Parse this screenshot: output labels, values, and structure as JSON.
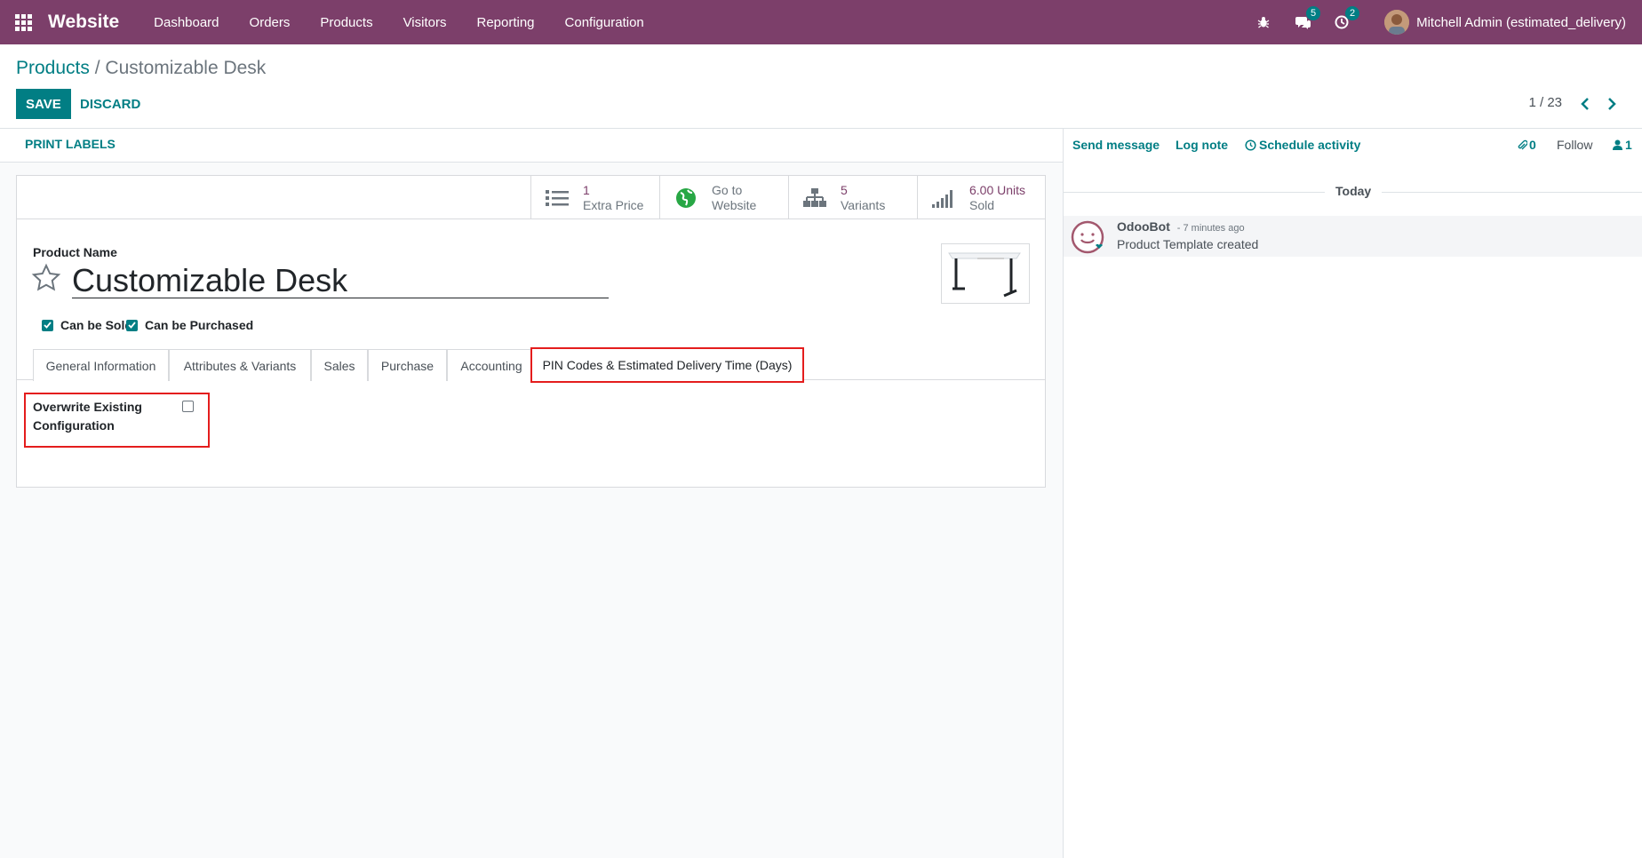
{
  "navbar": {
    "app_name": "Website",
    "menu": [
      "Dashboard",
      "Orders",
      "Products",
      "Visitors",
      "Reporting",
      "Configuration"
    ],
    "messages_count": "5",
    "activities_count": "2",
    "user": "Mitchell Admin (estimated_delivery)",
    "color": "#7c3f6a"
  },
  "breadcrumb": {
    "parent": "Products",
    "separator": "/",
    "current": "Customizable Desk"
  },
  "actions": {
    "save": "SAVE",
    "discard": "DISCARD"
  },
  "pager": {
    "text": "1 / 23"
  },
  "statusbar": {
    "print_labels": "PRINT LABELS"
  },
  "smart_buttons": [
    {
      "value": "1",
      "label": "Extra Price",
      "icon": "list-icon"
    },
    {
      "value": "Go to",
      "label": "Website",
      "icon": "globe-icon"
    },
    {
      "value": "5",
      "label": "Variants",
      "icon": "sitemap-icon"
    },
    {
      "value": "6.00 Units",
      "label": "Sold",
      "icon": "signal-icon"
    }
  ],
  "product": {
    "name_label": "Product Name",
    "name": "Customizable Desk",
    "can_be_sold": "Can be Sold",
    "can_be_purchased": "Can be Purchased"
  },
  "tabs": [
    "General Information",
    "Attributes & Variants",
    "Sales",
    "Purchase",
    "Accounting",
    "PIN Codes & Estimated Delivery Time (Days)"
  ],
  "pin_tab": {
    "overwrite_label": "Overwrite Existing Configuration"
  },
  "chatter": {
    "send_message": "Send message",
    "log_note": "Log note",
    "schedule_activity": "Schedule activity",
    "attachments": "0",
    "follow": "Follow",
    "followers": "1",
    "date_separator": "Today",
    "message": {
      "author": "OdooBot",
      "time": "- 7 minutes ago",
      "body": "Product Template created"
    }
  },
  "colors": {
    "primary": "#017e84",
    "highlight": "#e41d1d"
  }
}
